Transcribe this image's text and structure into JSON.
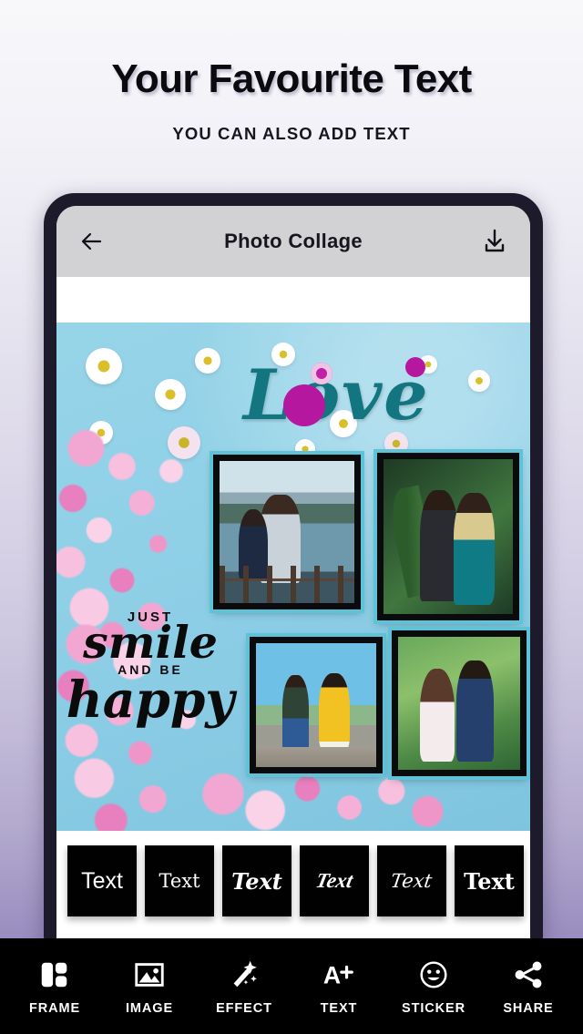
{
  "promo": {
    "title": "Your Favourite Text",
    "subtitle": "YOU CAN ALSO ADD TEXT"
  },
  "phone": {
    "appbar": {
      "title": "Photo Collage",
      "back_icon": "back-arrow-icon",
      "download_icon": "download-icon",
      "background_color": "#d2d2d4"
    },
    "collage": {
      "background_color": "#8fd0e7",
      "background_description": "light blue backdrop with white daisies and pink cherry blossoms",
      "stickers": [
        {
          "name": "love-sticker",
          "text": "Love",
          "color": "#13757f",
          "accent_color": "#b5179e"
        },
        {
          "name": "smile-sticker",
          "line1": "JUST",
          "line2": "smile",
          "line3": "AND BE",
          "line4": "happy",
          "color": "#0b0b0b"
        }
      ],
      "photos": [
        {
          "name": "photo-couple-lake",
          "caption": "couple embracing by a lake"
        },
        {
          "name": "photo-couple-formal",
          "caption": "couple in formal wear among palms"
        },
        {
          "name": "photo-couple-walk",
          "caption": "couple walking holding hands"
        },
        {
          "name": "photo-couple-garden",
          "caption": "couple in a green garden"
        }
      ],
      "frame_border_color": "#0b0b0d",
      "frame_glow_color": "#5fc3d8"
    },
    "font_strip": {
      "tiles": [
        {
          "label": "Text",
          "style": "sans"
        },
        {
          "label": "Text",
          "style": "serif"
        },
        {
          "label": "Text",
          "style": "script-bold"
        },
        {
          "label": "Text",
          "style": "script-slant"
        },
        {
          "label": "Text",
          "style": "script-thin"
        },
        {
          "label": "Text",
          "style": "serif-bold"
        }
      ],
      "background_color": "#ffffff",
      "tile_color": "#010101"
    }
  },
  "bottom_nav": {
    "background_color": "#000000",
    "items": [
      {
        "label": "FRAME",
        "icon": "frame-grid-icon"
      },
      {
        "label": "IMAGE",
        "icon": "image-icon"
      },
      {
        "label": "EFFECT",
        "icon": "magic-wand-icon"
      },
      {
        "label": "TEXT",
        "icon": "text-a-plus-icon"
      },
      {
        "label": "STICKER",
        "icon": "smiley-icon"
      },
      {
        "label": "SHARE",
        "icon": "share-nodes-icon"
      }
    ]
  }
}
